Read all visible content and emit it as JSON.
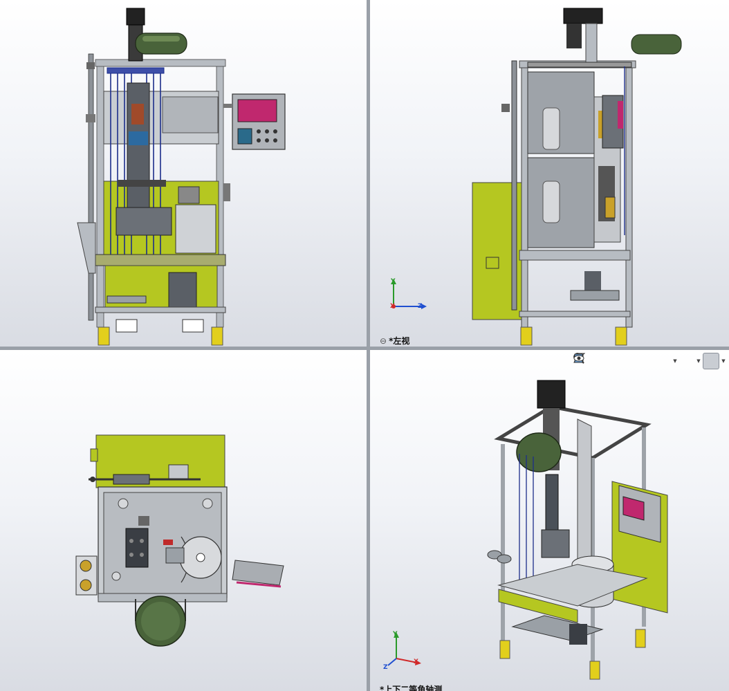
{
  "viewports": {
    "top_left": {
      "label": ""
    },
    "top_right": {
      "label": "*左视"
    },
    "bottom_left": {
      "label": ""
    },
    "bottom_right": {
      "label": "*上下二等角轴测"
    }
  },
  "triad": {
    "x": "X",
    "y": "Y",
    "z": "Z"
  },
  "toolbar": {
    "buttons": [
      "zoom-to-fit",
      "zoom-to-area",
      "previous-view",
      "section-view",
      "dynamic-annotation",
      "view-orientation",
      "display-style",
      "hide-show-items",
      "view-settings"
    ]
  },
  "colors": {
    "machine_green": "#b5c721",
    "frame_gray": "#b7bcc2",
    "panel_gray": "#a9adb2",
    "hmi_screen": "#c0286e",
    "rail_blue": "#1c2d8a",
    "foot_yellow": "#e2cf1c"
  }
}
